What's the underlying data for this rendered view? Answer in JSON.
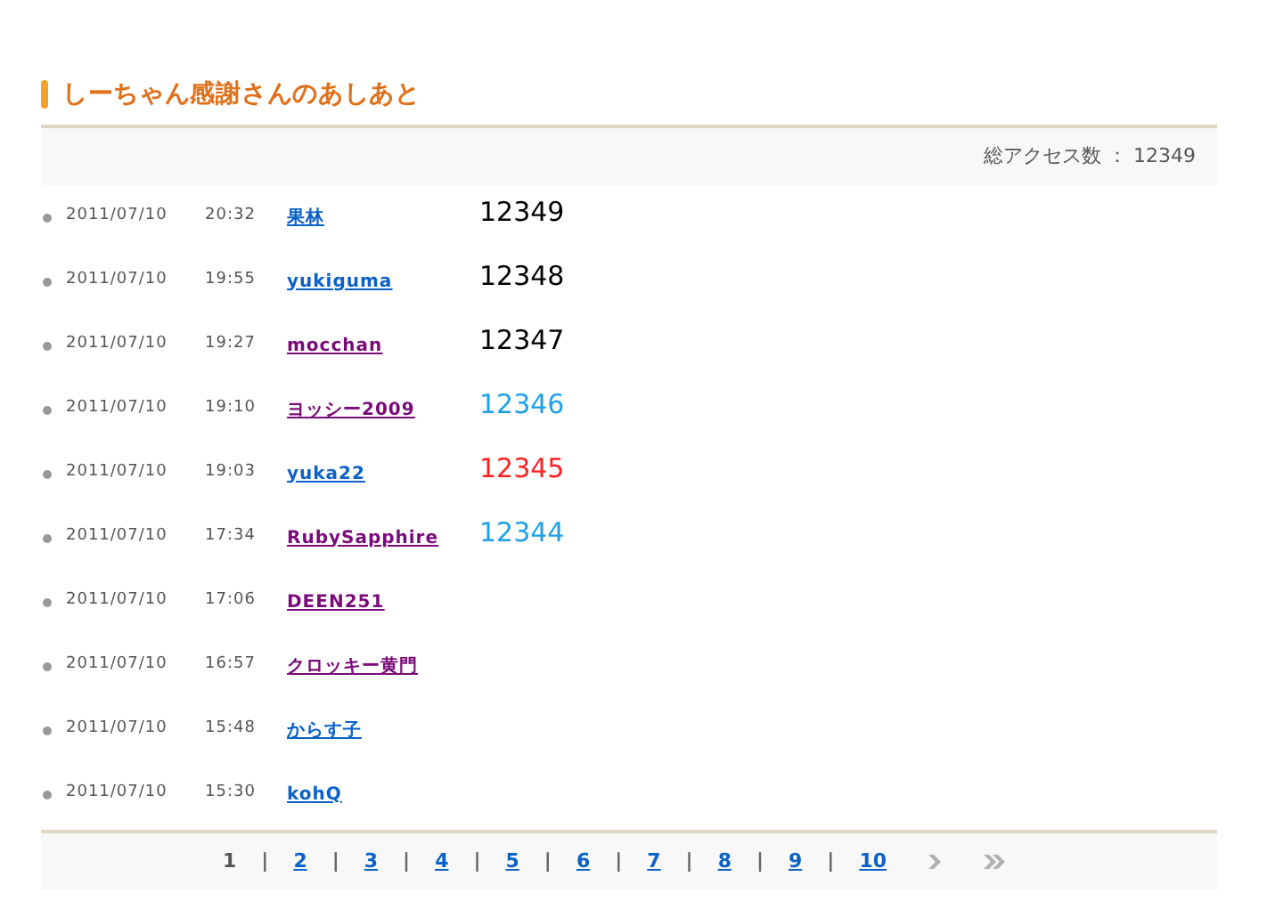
{
  "title": "しーちゃん感謝さんのあしあと",
  "total_access": "総アクセス数 ： 12349",
  "rows": [
    {
      "date": "2011/07/10",
      "time": "20:32",
      "name": "果林",
      "visited": false,
      "count": "12349",
      "color": "#000000"
    },
    {
      "date": "2011/07/10",
      "time": "19:55",
      "name": "yukiguma",
      "visited": false,
      "count": "12348",
      "color": "#000000"
    },
    {
      "date": "2011/07/10",
      "time": "19:27",
      "name": "mocchan",
      "visited": true,
      "count": "12347",
      "color": "#000000"
    },
    {
      "date": "2011/07/10",
      "time": "19:10",
      "name": "ヨッシー2009",
      "visited": true,
      "count": "12346",
      "color": "#1ea0e6"
    },
    {
      "date": "2011/07/10",
      "time": "19:03",
      "name": "yuka22",
      "visited": false,
      "count": "12345",
      "color": "#ff2020"
    },
    {
      "date": "2011/07/10",
      "time": "17:34",
      "name": "RubySapphire",
      "visited": true,
      "count": "12344",
      "color": "#1ea0e6"
    },
    {
      "date": "2011/07/10",
      "time": "17:06",
      "name": "DEEN251",
      "visited": true
    },
    {
      "date": "2011/07/10",
      "time": "16:57",
      "name": "クロッキー黄門",
      "visited": true
    },
    {
      "date": "2011/07/10",
      "time": "15:48",
      "name": "からす子",
      "visited": false
    },
    {
      "date": "2011/07/10",
      "time": "15:30",
      "name": "kohQ",
      "visited": false
    }
  ],
  "pager": [
    {
      "label": "1",
      "selected": true
    },
    {
      "label": "2",
      "selected": false
    },
    {
      "label": "3",
      "selected": false
    },
    {
      "label": "4",
      "selected": false
    },
    {
      "label": "5",
      "selected": false
    },
    {
      "label": "6",
      "selected": false
    },
    {
      "label": "7",
      "selected": false
    },
    {
      "label": "8",
      "selected": false
    },
    {
      "label": "9",
      "selected": false
    },
    {
      "label": "10",
      "selected": false
    }
  ],
  "separator": "|"
}
